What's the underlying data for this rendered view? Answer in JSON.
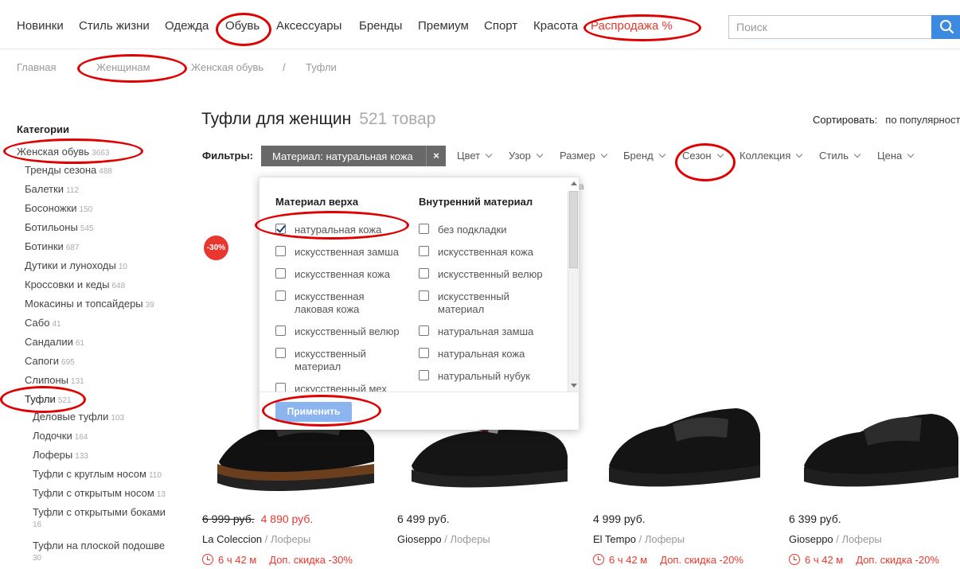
{
  "nav": {
    "items": [
      "Новинки",
      "Стиль жизни",
      "Одежда",
      "Обувь",
      "Аксессуары",
      "Бренды",
      "Премиум",
      "Спорт",
      "Красота",
      "Распродажа %"
    ]
  },
  "search": {
    "placeholder": "Поиск",
    "icon": "search-icon"
  },
  "breadcrumb": [
    "Главная",
    "Женщинам",
    "Женская обувь",
    "/",
    "Туфли"
  ],
  "sidebar": {
    "title": "Категории",
    "root": {
      "label": "Женская обувь",
      "count": "3663"
    },
    "items": [
      {
        "label": "Тренды сезона",
        "count": "488"
      },
      {
        "label": "Балетки",
        "count": "112"
      },
      {
        "label": "Босоножки",
        "count": "150"
      },
      {
        "label": "Ботильоны",
        "count": "545"
      },
      {
        "label": "Ботинки",
        "count": "687"
      },
      {
        "label": "Дутики и луноходы",
        "count": "10"
      },
      {
        "label": "Кроссовки и кеды",
        "count": "648"
      },
      {
        "label": "Мокасины и топсайдеры",
        "count": "39"
      },
      {
        "label": "Сабо",
        "count": "41"
      },
      {
        "label": "Сандалии",
        "count": "61"
      },
      {
        "label": "Сапоги",
        "count": "695"
      },
      {
        "label": "Слипоны",
        "count": "131"
      },
      {
        "label": "Туфли",
        "count": "521"
      }
    ],
    "subitems": [
      {
        "label": "Деловые туфли",
        "count": "103"
      },
      {
        "label": "Лодочки",
        "count": "164"
      },
      {
        "label": "Лоферы",
        "count": "133"
      },
      {
        "label": "Туфли с круглым носом",
        "count": "110"
      },
      {
        "label": "Туфли с открытым носом",
        "count": "13"
      },
      {
        "label": "Туфли с открытыми боками",
        "count": "16"
      },
      {
        "label": "Туфли на плоской подошве",
        "count": "30"
      }
    ]
  },
  "header": {
    "title": "Туфли для женщин",
    "count": "521 товар"
  },
  "sort": {
    "label": "Сортировать:",
    "value": "по популярности"
  },
  "filters": {
    "label": "Фильтры:",
    "active_chip": "Материал: натуральная кожа",
    "remove": "×",
    "dropdowns": [
      "Цвет",
      "Узор",
      "Размер",
      "Бренд",
      "Сезон",
      "Коллекция",
      "Стиль",
      "Цена"
    ]
  },
  "material_dropdown": {
    "col1_title": "Материал верха",
    "col2_title": "Внутренний материал",
    "col1": [
      {
        "label": "натуральная кожа",
        "checked": true
      },
      {
        "label": "искусственная замша",
        "checked": false
      },
      {
        "label": "искусственная кожа",
        "checked": false
      },
      {
        "label": "искусственная лаковая кожа",
        "checked": false
      },
      {
        "label": "искусственный велюр",
        "checked": false
      },
      {
        "label": "искусственный материал",
        "checked": false
      },
      {
        "label": "искусственный мех",
        "checked": false
      }
    ],
    "col2": [
      {
        "label": "без подкладки",
        "checked": false
      },
      {
        "label": "искусственная кожа",
        "checked": false
      },
      {
        "label": "искусственный велюр",
        "checked": false
      },
      {
        "label": "искусственный материал",
        "checked": false
      },
      {
        "label": "натуральная замша",
        "checked": false
      },
      {
        "label": "натуральная кожа",
        "checked": false
      },
      {
        "label": "натуральный нубук",
        "checked": false
      }
    ],
    "apply": "Применить",
    "partial_text": "а"
  },
  "products": [
    {
      "badge": "-30%",
      "old_price": "6 999 руб.",
      "price": "4 890 руб.",
      "brand": "La Coleccion",
      "type": "/ Лоферы",
      "timer": "6 ч 42 м",
      "discount": "Доп. скидка -30%"
    },
    {
      "price": "6 499 руб.",
      "brand": "Gioseppo",
      "type": "/ Лоферы"
    },
    {
      "price": "4 999 руб.",
      "brand": "El Tempo",
      "type": "/ Лоферы",
      "timer": "6 ч 42 м",
      "discount": "Доп. скидка -20%"
    },
    {
      "price": "6 399 руб.",
      "brand": "Gioseppo",
      "type": "/ Лоферы",
      "timer": "6 ч 42 м",
      "discount": "Доп. скидка -20%"
    }
  ],
  "colors": {
    "accent": "#3d8be0",
    "sale": "#e8372f",
    "annotation": "#e00000"
  }
}
